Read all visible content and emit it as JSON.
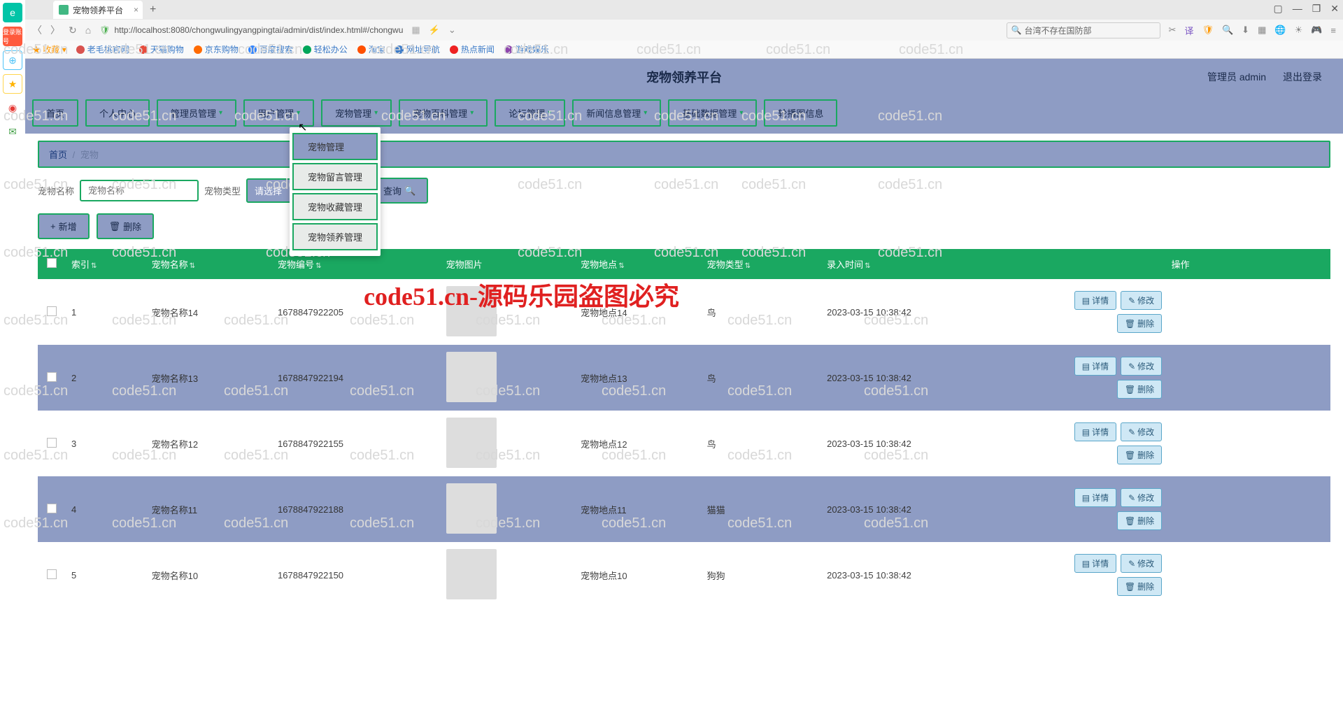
{
  "browser": {
    "tab_title": "宠物领养平台",
    "url": "http://localhost:8080/chongwulingyangpingtai/admin/dist/index.html#/chongwu",
    "search_placeholder": "台湾不存在国防部",
    "favorites_label": "收藏",
    "bookmarks": [
      {
        "label": "老毛桃官网",
        "color": "#d9534f"
      },
      {
        "label": "天猫购物",
        "color": "#e74c3c"
      },
      {
        "label": "京东购物",
        "color": "#ff6a00"
      },
      {
        "label": "百度搜索",
        "color": "#3385ff"
      },
      {
        "label": "轻松办公",
        "color": "#00a65a"
      },
      {
        "label": "淘宝",
        "color": "#ff5000"
      },
      {
        "label": "网址导航",
        "color": "#3b7ac7"
      },
      {
        "label": "热点新闻",
        "color": "#e22"
      },
      {
        "label": "游戏娱乐",
        "color": "#8e44ad"
      }
    ]
  },
  "app": {
    "title": "宠物领养平台",
    "admin_label": "管理员 admin",
    "logout_label": "退出登录"
  },
  "nav": {
    "items": [
      {
        "label": "首页",
        "caret": false
      },
      {
        "label": "个人中心",
        "caret": false
      },
      {
        "label": "管理员管理",
        "caret": true
      },
      {
        "label": "用户管理",
        "caret": true
      },
      {
        "label": "宠物管理",
        "caret": true
      },
      {
        "label": "宠物百科管理",
        "caret": true
      },
      {
        "label": "论坛管理",
        "caret": true
      },
      {
        "label": "新闻信息管理",
        "caret": true
      },
      {
        "label": "基础数据管理",
        "caret": true
      },
      {
        "label": "轮播图信息",
        "caret": false
      }
    ],
    "dropdown": [
      "宠物管理",
      "宠物留言管理",
      "宠物收藏管理",
      "宠物领养管理"
    ]
  },
  "breadcrumb": {
    "home": "首页",
    "current": "宠物"
  },
  "filter": {
    "name_label": "宠物名称",
    "name_placeholder": "宠物名称",
    "type_label": "宠物类型",
    "type_placeholder": "请选择",
    "query_label": "查询"
  },
  "actions": {
    "add": "新增",
    "delete": "删除"
  },
  "table": {
    "headers": [
      "索引",
      "宠物名称",
      "宠物编号",
      "宠物图片",
      "宠物地点",
      "宠物类型",
      "录入时间",
      "操作"
    ],
    "op_labels": {
      "detail": "详情",
      "edit": "修改",
      "delete": "删除"
    },
    "rows": [
      {
        "idx": "1",
        "name": "宠物名称14",
        "code": "1678847922205",
        "place": "宠物地点14",
        "type": "鸟",
        "time": "2023-03-15 10:38:42"
      },
      {
        "idx": "2",
        "name": "宠物名称13",
        "code": "1678847922194",
        "place": "宠物地点13",
        "type": "鸟",
        "time": "2023-03-15 10:38:42"
      },
      {
        "idx": "3",
        "name": "宠物名称12",
        "code": "1678847922155",
        "place": "宠物地点12",
        "type": "鸟",
        "time": "2023-03-15 10:38:42"
      },
      {
        "idx": "4",
        "name": "宠物名称11",
        "code": "1678847922188",
        "place": "宠物地点11",
        "type": "猫猫",
        "time": "2023-03-15 10:38:42"
      },
      {
        "idx": "5",
        "name": "宠物名称10",
        "code": "1678847922150",
        "place": "宠物地点10",
        "type": "狗狗",
        "time": "2023-03-15 10:38:42"
      }
    ]
  },
  "watermark": "code51.cn-源码乐园盗图必究",
  "watermark_light": "code51.cn"
}
